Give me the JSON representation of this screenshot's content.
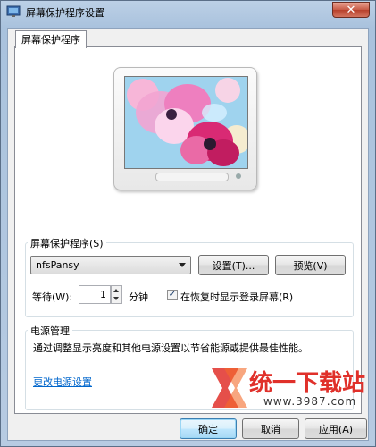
{
  "window": {
    "title": "屏幕保护程序设置",
    "close_glyph": "✕"
  },
  "tabs": [
    {
      "label": "屏幕保护程序"
    }
  ],
  "screensaver": {
    "group_label": "屏幕保护程序(S)",
    "selected": "nfsPansy",
    "settings_button": "设置(T)...",
    "preview_button": "预览(V)",
    "wait_label": "等待(W):",
    "wait_value": "1",
    "wait_unit": "分钟",
    "resume_checkbox_label": "在恢复时显示登录屏幕(R)",
    "resume_checked": true
  },
  "power": {
    "group_label": "电源管理",
    "description": "通过调整显示亮度和其他电源设置以节省能源或提供最佳性能。",
    "link": "更改电源设置"
  },
  "buttons": {
    "ok": "确定",
    "cancel": "取消",
    "apply": "应用(A)"
  },
  "watermark": {
    "text": "统一下载站",
    "url": "www.3987.com"
  },
  "colors": {
    "link": "#0066cc",
    "title_bar": "#bcd0e6",
    "watermark_red": "#e0302a"
  }
}
